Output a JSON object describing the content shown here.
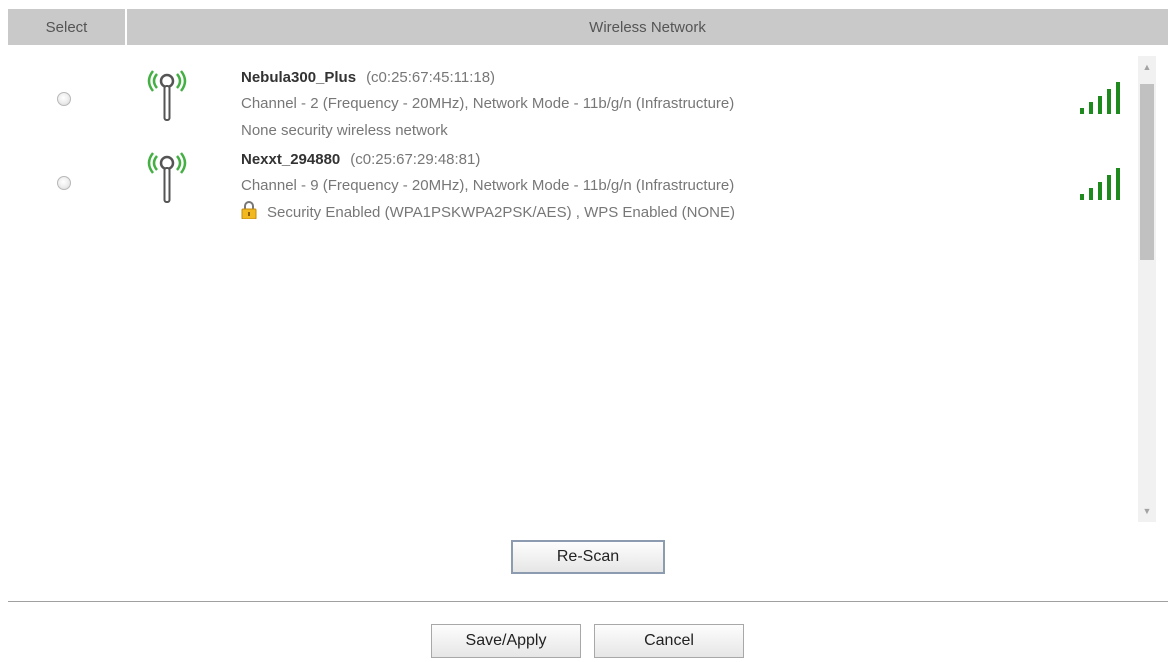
{
  "header": {
    "select_label": "Select",
    "network_label": "Wireless Network"
  },
  "networks": [
    {
      "name": "Nebula300_Plus",
      "mac": "(c0:25:67:45:11:18)",
      "details": "Channel - 2 (Frequency - 20MHz), Network Mode - 11b/g/n (Infrastructure)",
      "security": "None security wireless network",
      "secured": false,
      "signal_bars": 5
    },
    {
      "name": "Nexxt_294880",
      "mac": "(c0:25:67:29:48:81)",
      "details": "Channel - 9 (Frequency - 20MHz), Network Mode - 11b/g/n (Infrastructure)",
      "security": "Security Enabled (WPA1PSKWPA2PSK/AES) , WPS Enabled (NONE)",
      "secured": true,
      "signal_bars": 5
    }
  ],
  "buttons": {
    "rescan": "Re-Scan",
    "save": "Save/Apply",
    "cancel": "Cancel"
  },
  "icons": {
    "antenna": "wireless-antenna-icon",
    "signal": "signal-strength-icon",
    "lock": "lock-icon"
  },
  "colors": {
    "header_bg": "#c9c9c9",
    "signal_green": "#1e8a1e",
    "antenna_wave": "#44b044",
    "lock_gold": "#f2b81f"
  }
}
